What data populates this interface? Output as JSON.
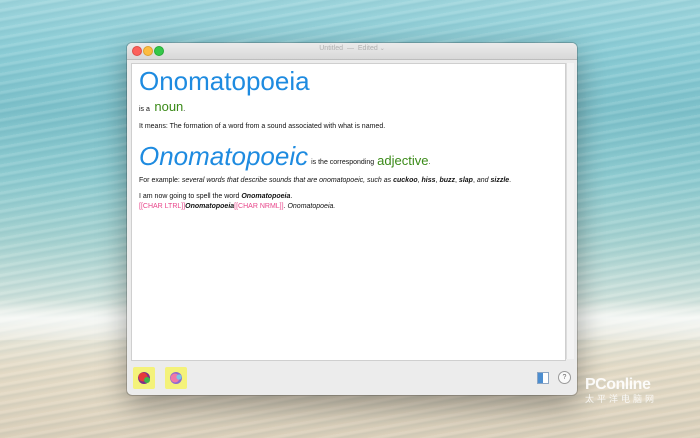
{
  "window": {
    "title": "Untitled",
    "separator": "—",
    "status": "Edited",
    "chevron": "⌄"
  },
  "doc": {
    "headword": "Onomatopoeia",
    "pos_line_prefix": "is a",
    "pos": "noun",
    "pos_suffix": ".",
    "meaning": "It means: The formation of a word from a sound associated with what is named.",
    "adjective_word": "Onomatopoeic",
    "adjective_mid": "is the corresponding",
    "adjective_pos": "adjective",
    "adjective_suffix": ".",
    "example_prefix": "For example:",
    "example_text": "several words that describe sounds that are onomatopoeic, such as",
    "example_words": [
      "cuckoo",
      "hiss",
      "buzz",
      "slap"
    ],
    "example_and": "and",
    "example_last": "sizzle",
    "example_end": ".",
    "spell_prefix": "I am now going to spell the word",
    "spell_word": "Onomatopoeia",
    "spell_end": ".",
    "char_ltrl": "[[CHAR LTRL]]",
    "char_word": "Onomatopoeia",
    "char_nrml": "[[CHAR NRML]]",
    "char_after": ". Onomatopoeia."
  },
  "bottom": {
    "help_label": "?"
  },
  "watermark": {
    "brand": "PConline",
    "sub": "太平洋电脑网"
  },
  "colors": {
    "headword_blue": "#1e8be0",
    "pos_green": "#3a8a18",
    "tag_pink": "#e8458a"
  }
}
